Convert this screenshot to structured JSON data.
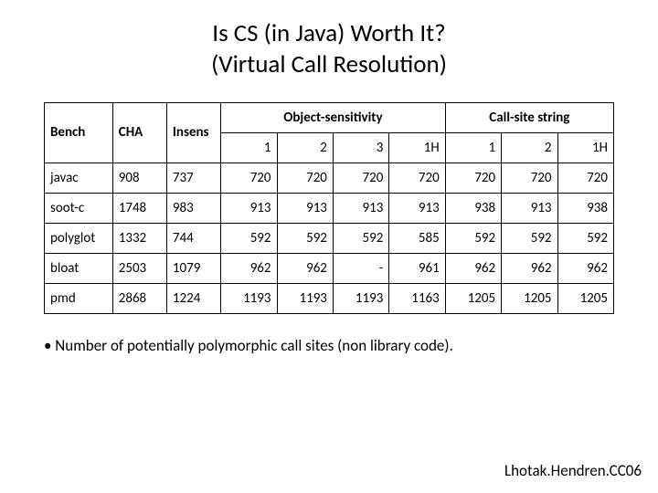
{
  "title_line1": "Is CS (in Java) Worth It?",
  "title_line2": "(Virtual Call Resolution)",
  "headers": {
    "bench": "Bench",
    "cha": "CHA",
    "insens": "Insens",
    "group_obj": "Object-sensitivity",
    "group_css": "Call-site string",
    "obj1": "1",
    "obj2": "2",
    "obj3": "3",
    "obj1H": "1H",
    "css1": "1",
    "css2": "2",
    "css1H": "1H"
  },
  "rows": [
    {
      "bench": "javac",
      "cha": "908",
      "insens": "737",
      "o1": "720",
      "o2": "720",
      "o3": "720",
      "o1H": "720",
      "c1": "720",
      "c2": "720",
      "c1H": "720"
    },
    {
      "bench": "soot-c",
      "cha": "1748",
      "insens": "983",
      "o1": "913",
      "o2": "913",
      "o3": "913",
      "o1H": "913",
      "c1": "938",
      "c2": "913",
      "c1H": "938"
    },
    {
      "bench": "polyglot",
      "cha": "1332",
      "insens": "744",
      "o1": "592",
      "o2": "592",
      "o3": "592",
      "o1H": "585",
      "c1": "592",
      "c2": "592",
      "c1H": "592"
    },
    {
      "bench": "bloat",
      "cha": "2503",
      "insens": "1079",
      "o1": "962",
      "o2": "962",
      "o3": "-",
      "o1H": "961",
      "c1": "962",
      "c2": "962",
      "c1H": "962"
    },
    {
      "bench": "pmd",
      "cha": "2868",
      "insens": "1224",
      "o1": "1193",
      "o2": "1193",
      "o3": "1193",
      "o1H": "1163",
      "c1": "1205",
      "c2": "1205",
      "c1H": "1205"
    }
  ],
  "note": "• Number of potentially polymorphic call sites (non library code).",
  "credit": "Lhotak.Hendren.CC06",
  "chart_data": {
    "type": "table",
    "title": "Is CS (in Java) Worth It? (Virtual Call Resolution)",
    "columns": [
      "Bench",
      "CHA",
      "Insens",
      "Obj-1",
      "Obj-2",
      "Obj-3",
      "Obj-1H",
      "CSS-1",
      "CSS-2",
      "CSS-1H"
    ],
    "rows": [
      [
        "javac",
        908,
        737,
        720,
        720,
        720,
        720,
        720,
        720,
        720
      ],
      [
        "soot-c",
        1748,
        983,
        913,
        913,
        913,
        913,
        938,
        913,
        938
      ],
      [
        "polyglot",
        1332,
        744,
        592,
        592,
        592,
        585,
        592,
        592,
        592
      ],
      [
        "bloat",
        2503,
        1079,
        962,
        962,
        null,
        961,
        962,
        962,
        962
      ],
      [
        "pmd",
        2868,
        1224,
        1193,
        1193,
        1193,
        1163,
        1205,
        1205,
        1205
      ]
    ],
    "note": "Number of potentially polymorphic call sites (non library code)."
  }
}
